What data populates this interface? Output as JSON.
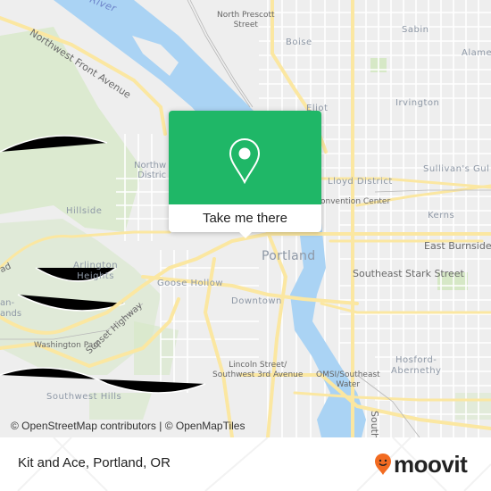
{
  "map": {
    "labels": {
      "river": "River",
      "nw_front_ave": "Northwest Front Avenue",
      "north_prescott_1": "North Prescott",
      "north_prescott_2": "Street",
      "boise": "Boise",
      "sabin": "Sabin",
      "alameda": "Alame",
      "eliot": "Eliot",
      "irvington": "Irvington",
      "northwest_district_1": "Northw",
      "northwest_district_2": "Distric",
      "sullivans_gulch": "Sullivan's Gul",
      "lloyd_district": "Lloyd District",
      "convention_center": "onvention Center",
      "hillside": "Hillside",
      "kerns": "Kerns",
      "road": "ad",
      "portland": "Portland",
      "east_burnside": "East Burnside S",
      "arlington_1": "Arlington",
      "arlington_2": "Heights",
      "se_stark": "Southeast Stark Street",
      "goose_hollow": "Goose Hollow",
      "downtown": "Downtown",
      "hoyt_1": "an-",
      "hoyt_2": "ands",
      "washington_park": "Washington Park",
      "sunset_highway": "Sunset Highway",
      "hosford_1": "Hosford-",
      "hosford_2": "Abernethy",
      "lincoln_1": "Lincoln Street/",
      "lincoln_2": "Southwest 3rd Avenue",
      "omsi_1": "OMSI/Southeast",
      "omsi_2": "Water",
      "southwest_hills": "Southwest Hills",
      "south": "South"
    },
    "colors": {
      "land": "#eeeeee",
      "water": "#aad3f4",
      "park": "#d6e8c6",
      "road_major": "#fbe7a1",
      "road_minor": "#ffffff"
    }
  },
  "popup": {
    "button_label": "Take me there",
    "accent": "#1fb767",
    "icon": "map-pin-icon"
  },
  "attribution": "© OpenStreetMap contributors | © OpenMapTiles",
  "footer": {
    "place_title": "Kit and Ace, Portland, OR",
    "brand": "moovit",
    "brand_color": "#f26b21"
  }
}
